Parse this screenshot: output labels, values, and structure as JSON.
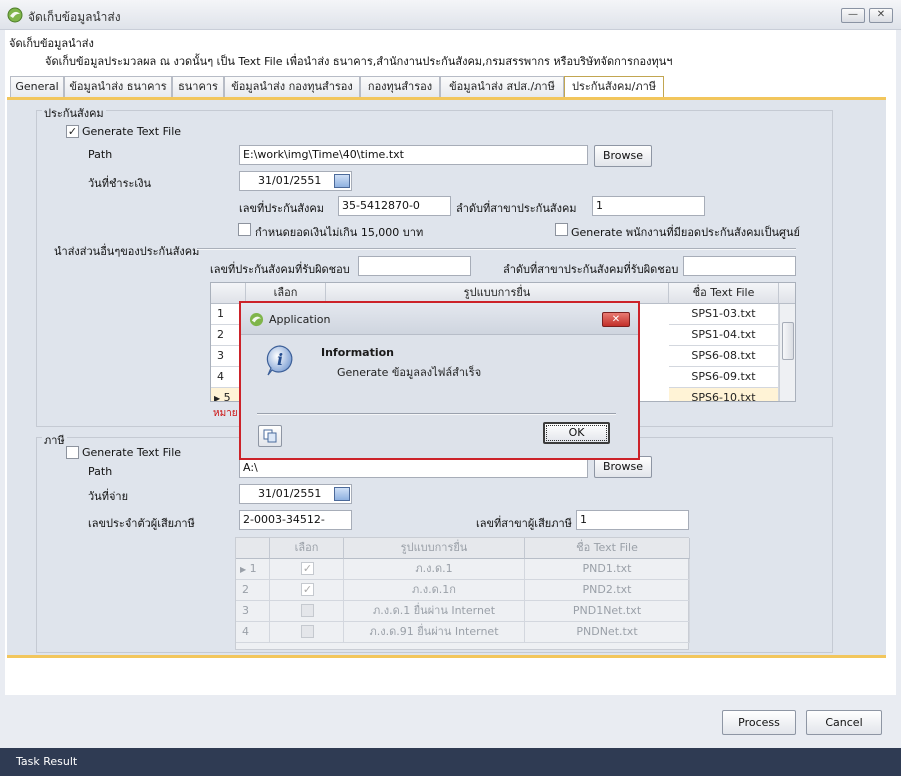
{
  "window": {
    "title": "จัดเก็บข้อมูลนำส่ง",
    "minimize": "—",
    "close": "✕"
  },
  "header": {
    "title": "จัดเก็บข้อมูลนำส่ง",
    "description": "จัดเก็บข้อมูลประมวลผล ณ งวดนั้นๆ เป็น Text File เพื่อนำส่ง ธนาคาร,สำนักงานประกันสังคม,กรมสรรพากร หรือบริษัทจัดการกองทุนฯ"
  },
  "tabs": [
    {
      "label": "General"
    },
    {
      "label": "ข้อมูลนำส่ง ธนาคาร"
    },
    {
      "label": "ธนาคาร"
    },
    {
      "label": "ข้อมูลนำส่ง กองทุนสำรอง"
    },
    {
      "label": "กองทุนสำรอง"
    },
    {
      "label": "ข้อมูลนำส่ง สปส./ภาษี"
    },
    {
      "label": "ประกันสังคม/ภาษี"
    }
  ],
  "social": {
    "group_label": "ประกันสังคม",
    "generate_label": "Generate Text File",
    "generate_checked": "✓",
    "path_label": "Path",
    "path_value": "E:\\work\\img\\Time\\40\\time.txt",
    "browse_label": "Browse",
    "paydate_label": "วันที่ชำระเงิน",
    "paydate_value": "31/01/2551",
    "ss_no_label": "เลขที่ประกันสังคม",
    "ss_no_value": "35-5412870-0",
    "branch_label": "ลำดับที่สาขาประกันสังคม",
    "branch_value": "1",
    "limit_label": "กำหนดยอดเงินไม่เกิน 15,000 บาท",
    "zero_label": "Generate พนักงานที่มียอดประกันสังคมเป็นศูนย์",
    "other_label": "นำส่งส่วนอื่นๆของประกันสังคม",
    "resp_no_label": "เลขที่ประกันสังคมที่รับผิดชอบ",
    "resp_no_value": "",
    "resp_branch_label": "ลำดับที่สาขาประกันสังคมที่รับผิดชอบ",
    "resp_branch_value": "",
    "grid_headers": [
      "เลือก",
      "รูปแบบการยื่น",
      "ชื่อ Text File"
    ],
    "rows": [
      {
        "num": "1",
        "file": "SPS1-03.txt"
      },
      {
        "num": "2",
        "file": "SPS1-04.txt"
      },
      {
        "num": "3",
        "file": "SPS6-08.txt"
      },
      {
        "num": "4",
        "file": "SPS6-09.txt"
      },
      {
        "num": "5",
        "file": "SPS6-10.txt"
      }
    ],
    "note": "หมาย"
  },
  "tax": {
    "group_label": "ภาษี",
    "generate_label": "Generate Text File",
    "path_label": "Path",
    "path_value": "A:\\",
    "browse_label": "Browse",
    "paydate_label": "วันที่จ่าย",
    "paydate_value": "31/01/2551",
    "taxid_label": "เลขประจำตัวผู้เสียภาษี",
    "taxid_value": "2-0003-34512-",
    "branch_label": "เลขที่สาขาผู้เสียภาษี",
    "branch_value": "1",
    "grid_headers": [
      "เลือก",
      "รูปแบบการยื่น",
      "ชื่อ Text File"
    ],
    "rows": [
      {
        "num": "1",
        "form": "ภ.ง.ด.1",
        "file": "PND1.txt"
      },
      {
        "num": "2",
        "form": "ภ.ง.ด.1ก",
        "file": "PND2.txt"
      },
      {
        "num": "3",
        "form": "ภ.ง.ด.1 ยื่นผ่าน Internet",
        "file": "PND1Net.txt"
      },
      {
        "num": "4",
        "form": "ภ.ง.ด.91 ยื่นผ่าน Internet",
        "file": "PNDNet.txt"
      }
    ]
  },
  "footer": {
    "process_label": "Process",
    "cancel_label": "Cancel"
  },
  "status": {
    "text": "Task Result"
  },
  "dialog": {
    "title": "Application",
    "heading": "Information",
    "message": "Generate ข้อมูลลงไฟล์สำเร็จ",
    "ok_label": "OK",
    "info_glyph": "i",
    "close": "✕"
  },
  "colors": {
    "accent": "#f2c65c",
    "dialog_border": "#cc2229",
    "status_bar": "#2f3b53",
    "note_red": "#cc1111"
  },
  "icons": [
    "app-icon",
    "info-icon",
    "copy-icon",
    "calendar-icon",
    "row-pointer-icon",
    "check-icon"
  ]
}
